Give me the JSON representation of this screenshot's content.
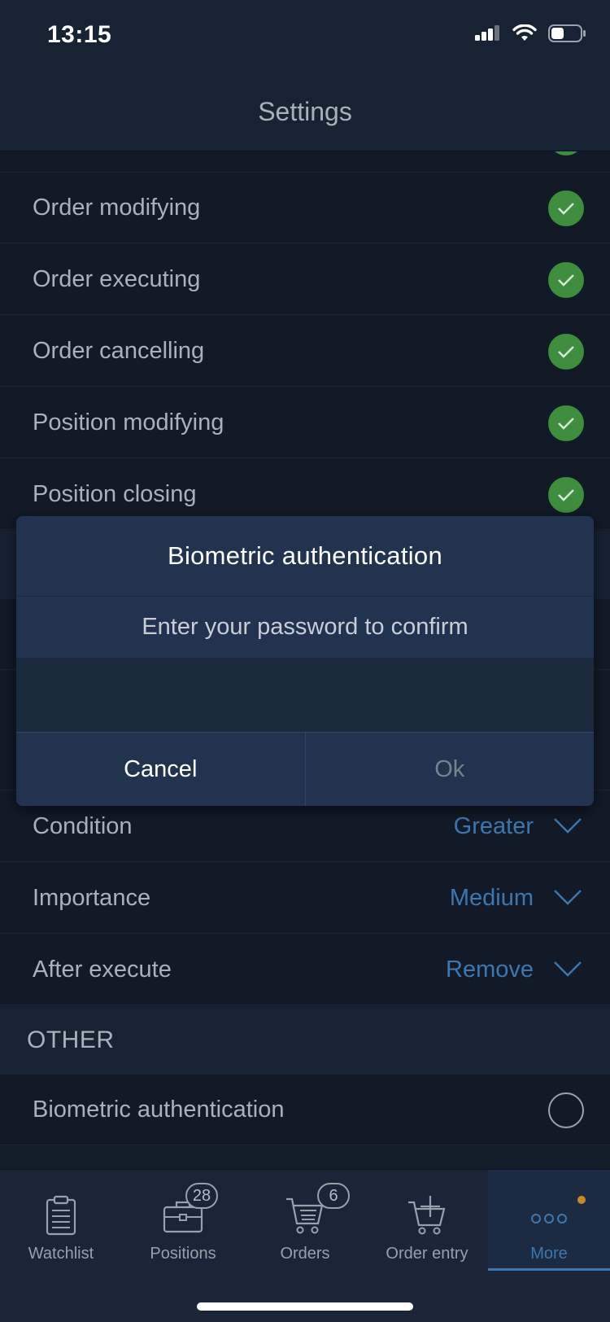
{
  "status_bar": {
    "time": "13:15"
  },
  "header": {
    "title": "Settings"
  },
  "settings_rows": [
    {
      "label": "Order modifying",
      "checked": true
    },
    {
      "label": "Order executing",
      "checked": true
    },
    {
      "label": "Order cancelling",
      "checked": true
    },
    {
      "label": "Position modifying",
      "checked": true
    },
    {
      "label": "Position closing",
      "checked": true
    }
  ],
  "alert_rows": [
    {
      "label": "Condition",
      "value": "Greater"
    },
    {
      "label": "Importance",
      "value": "Medium"
    },
    {
      "label": "After execute",
      "value": "Remove"
    }
  ],
  "other_section": {
    "title": "OTHER",
    "biometric": {
      "label": "Biometric authentication",
      "checked": false
    }
  },
  "dialog": {
    "title": "Biometric authentication",
    "message": "Enter your password to confirm",
    "password_value": "",
    "cancel_label": "Cancel",
    "ok_label": "Ok"
  },
  "tabs": [
    {
      "label": "Watchlist",
      "icon": "clipboard-icon",
      "badge": ""
    },
    {
      "label": "Positions",
      "icon": "briefcase-icon",
      "badge": "28"
    },
    {
      "label": "Orders",
      "icon": "cart-list-icon",
      "badge": "6"
    },
    {
      "label": "Order entry",
      "icon": "cart-plus-icon",
      "badge": ""
    },
    {
      "label": "More",
      "icon": "more-dots-icon",
      "badge": "",
      "active": true
    }
  ],
  "colors": {
    "accent": "#3c77b0",
    "check_green": "#3f8e3f",
    "notification_dot": "#c8892a"
  }
}
